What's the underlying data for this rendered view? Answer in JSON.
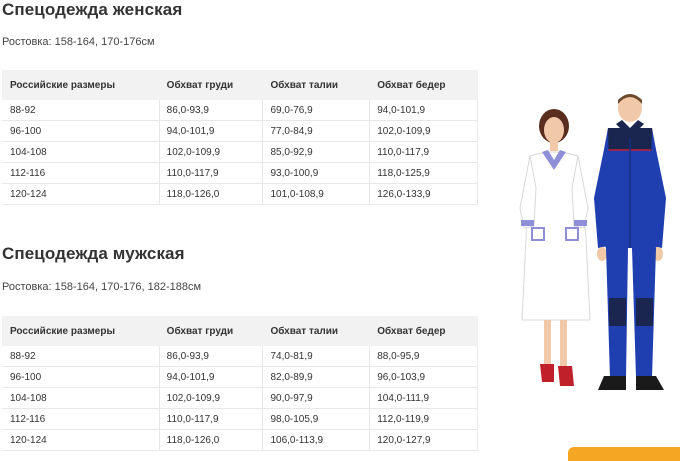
{
  "sections": [
    {
      "title": "Спецодежда женская",
      "heights": "Ростовка: 158-164, 170-176см",
      "headers": [
        "Российские размеры",
        "Обхват груди",
        "Обхват талии",
        "Обхват бедер"
      ],
      "rows": [
        [
          "88-92",
          "86,0-93,9",
          "69,0-76,9",
          "94,0-101,9"
        ],
        [
          "96-100",
          "94,0-101,9",
          "77,0-84,9",
          "102,0-109,9"
        ],
        [
          "104-108",
          "102,0-109,9",
          "85,0-92,9",
          "110,0-117,9"
        ],
        [
          "112-116",
          "110,0-117,9",
          "93,0-100,9",
          "118,0-125,9"
        ],
        [
          "120-124",
          "118,0-126,0",
          "101,0-108,9",
          "126,0-133,9"
        ]
      ]
    },
    {
      "title": "Спецодежда мужская",
      "heights": "Ростовка: 158-164, 170-176, 182-188см",
      "headers": [
        "Российские размеры",
        "Обхват груди",
        "Обхват талии",
        "Обхват бедер"
      ],
      "rows": [
        [
          "88-92",
          "86,0-93,9",
          "74,0-81,9",
          "88,0-95,9"
        ],
        [
          "96-100",
          "94,0-101,9",
          "82,0-89,9",
          "96,0-103,9"
        ],
        [
          "104-108",
          "102,0-109,9",
          "90,0-97,9",
          "104,0-111,9"
        ],
        [
          "112-116",
          "110,0-117,9",
          "98,0-105,9",
          "112,0-119,9"
        ],
        [
          "120-124",
          "118,0-126,0",
          "106,0-113,9",
          "120,0-127,9"
        ]
      ]
    }
  ],
  "colors": {
    "header_bg": "#f2f2f2",
    "woman_coat": "#ffffff",
    "woman_trim": "#8f8fd8",
    "man_overall": "#1f3fb0",
    "man_trim": "#1a2550",
    "shoes_red": "#c0202a",
    "chat_tab": "#f5a623"
  }
}
